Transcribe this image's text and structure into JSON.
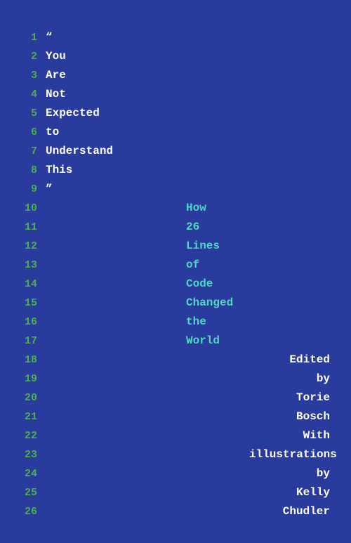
{
  "cover": {
    "background_color": "#2a3b9e",
    "lines": [
      {
        "number": "1",
        "text": "“",
        "column": 1
      },
      {
        "number": "2",
        "text": "You",
        "column": 1
      },
      {
        "number": "3",
        "text": "Are",
        "column": 1
      },
      {
        "number": "4",
        "text": "Not",
        "column": 1
      },
      {
        "number": "5",
        "text": "Expected",
        "column": 1
      },
      {
        "number": "6",
        "text": "to",
        "column": 1
      },
      {
        "number": "7",
        "text": "Understand",
        "column": 1
      },
      {
        "number": "8",
        "text": "This",
        "column": 1
      },
      {
        "number": "9",
        "text": "”",
        "column": 1
      },
      {
        "number": "10",
        "text": "How",
        "column": 2
      },
      {
        "number": "11",
        "text": "26",
        "column": 2
      },
      {
        "number": "12",
        "text": "Lines",
        "column": 2
      },
      {
        "number": "13",
        "text": "of",
        "column": 2
      },
      {
        "number": "14",
        "text": "Code",
        "column": 2
      },
      {
        "number": "15",
        "text": "Changed",
        "column": 2
      },
      {
        "number": "16",
        "text": "the",
        "column": 2
      },
      {
        "number": "17",
        "text": "World",
        "column": 2
      },
      {
        "number": "18",
        "text": "Edited",
        "column": 3
      },
      {
        "number": "19",
        "text": "by",
        "column": 3
      },
      {
        "number": "20",
        "text": "Torie",
        "column": 3
      },
      {
        "number": "21",
        "text": "Bosch",
        "column": 3
      },
      {
        "number": "22",
        "text": "With",
        "column": 4
      },
      {
        "number": "23",
        "text": "illustrations",
        "column": 4
      },
      {
        "number": "24",
        "text": "by",
        "column": 4
      },
      {
        "number": "25",
        "text": "Kelly",
        "column": 4
      },
      {
        "number": "26",
        "text": "Chudler",
        "column": 4
      }
    ]
  }
}
